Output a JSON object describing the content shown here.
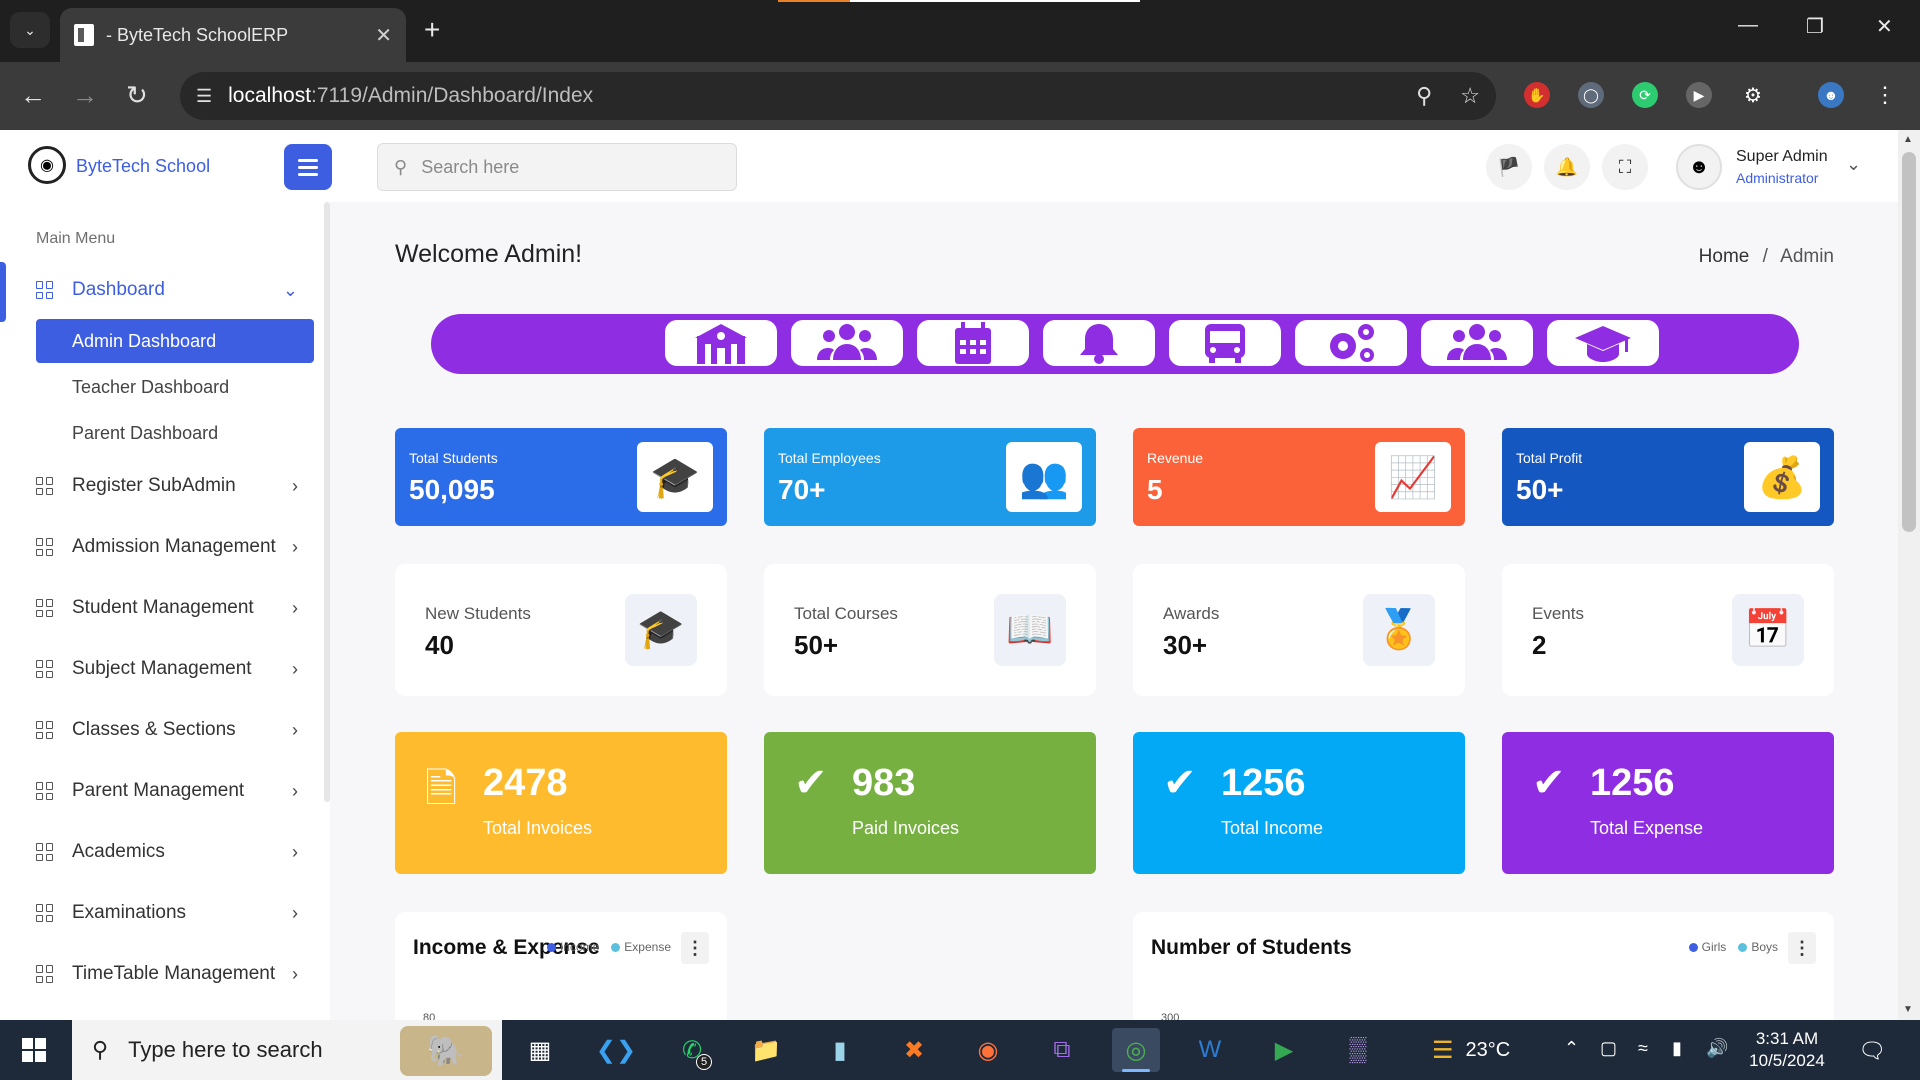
{
  "browser": {
    "tab_title": "- ByteTech SchoolERP",
    "url_host": "localhost",
    "url_path": ":7119/Admin/Dashboard/Index"
  },
  "header": {
    "logo_text": "ByteTech School",
    "search_placeholder": "Search here",
    "user_name": "Super Admin",
    "user_role": "Administrator"
  },
  "sidebar": {
    "menu_title": "Main Menu",
    "dashboard_label": "Dashboard",
    "sub_items": [
      "Admin Dashboard",
      "Teacher Dashboard",
      "Parent Dashboard"
    ],
    "items": [
      "Register SubAdmin",
      "Admission Management",
      "Student Management",
      "Subject Management",
      "Classes & Sections",
      "Parent Management",
      "Academics",
      "Examinations",
      "TimeTable Management"
    ]
  },
  "page": {
    "title": "Welcome Admin!",
    "breadcrumb_home": "Home",
    "breadcrumb_sep": "/",
    "breadcrumb_current": "Admin"
  },
  "quick_links": [
    "school-icon",
    "users-icon",
    "calendar-icon",
    "bell-icon",
    "bus-icon",
    "gears-icon",
    "group-icon",
    "graduation-cap-icon"
  ],
  "stat_cards": [
    {
      "label": "Total Students",
      "value": "50,095",
      "color": "#2b6de8"
    },
    {
      "label": "Total Employees",
      "value": "70+",
      "color": "#1e9be8"
    },
    {
      "label": "Revenue",
      "value": "5",
      "color": "#fb6239"
    },
    {
      "label": "Total Profit",
      "value": "50+",
      "color": "#1557c0"
    }
  ],
  "info_cards": [
    {
      "label": "New Students",
      "value": "40"
    },
    {
      "label": "Total Courses",
      "value": "50+"
    },
    {
      "label": "Awards",
      "value": "30+"
    },
    {
      "label": "Events",
      "value": "2"
    }
  ],
  "big_cards": [
    {
      "value": "2478",
      "label": "Total Invoices",
      "color": "#fdbb2d"
    },
    {
      "value": "983",
      "label": "Paid Invoices",
      "color": "#76b041"
    },
    {
      "value": "1256",
      "label": "Total Income",
      "color": "#03a9f4"
    },
    {
      "value": "1256",
      "label": "Total Expense",
      "color": "#8e2de2"
    }
  ],
  "charts": [
    {
      "title": "Income & Expense",
      "legend": [
        "Income",
        "Expense"
      ],
      "colors": [
        "#3d5ee1",
        "#5bc0de"
      ],
      "y_top_tick": "80"
    },
    {
      "title": "Number of Students",
      "legend": [
        "Girls",
        "Boys"
      ],
      "colors": [
        "#3d5ee1",
        "#5bc0de"
      ],
      "y_top_tick": "300"
    }
  ],
  "taskbar": {
    "search_text": "Type here to search",
    "whatsapp_badge": "5",
    "weather": "23°C",
    "time": "3:31 AM",
    "date": "10/5/2024"
  }
}
